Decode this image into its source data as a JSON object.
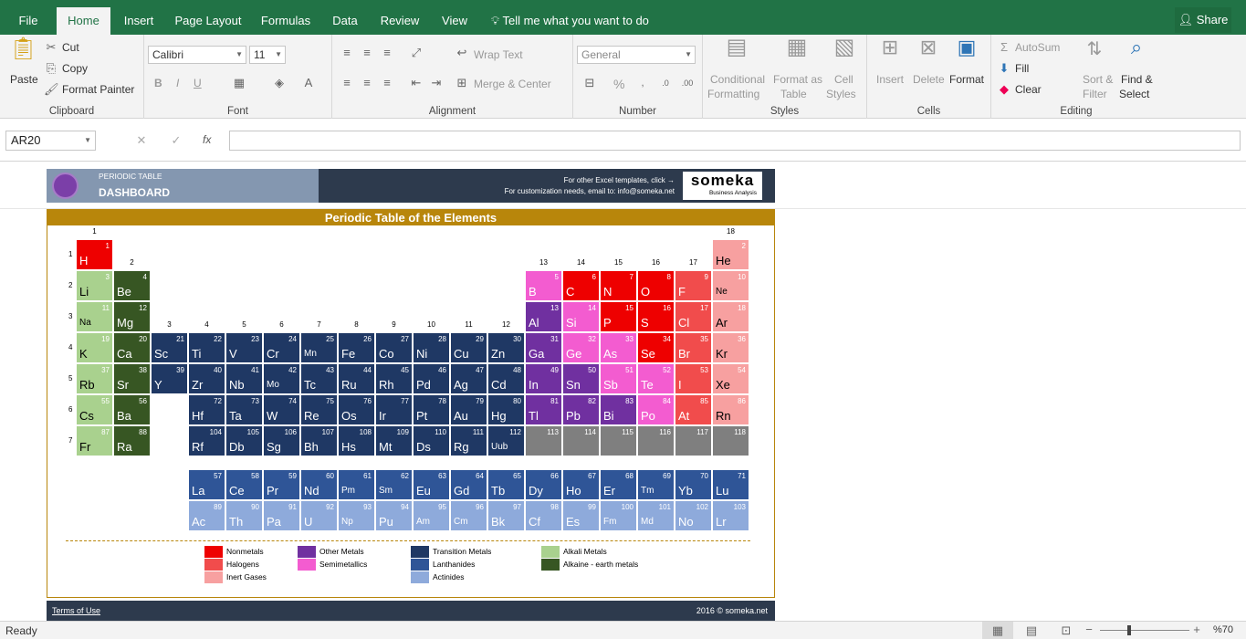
{
  "tabs": [
    "File",
    "Home",
    "Insert",
    "Page Layout",
    "Formulas",
    "Data",
    "Review",
    "View"
  ],
  "tell_me": "Tell me what you want to do",
  "share": "Share",
  "clipboard": {
    "paste": "Paste",
    "cut": "Cut",
    "copy": "Copy",
    "format_painter": "Format Painter",
    "label": "Clipboard"
  },
  "font": {
    "name": "Calibri",
    "size": "11",
    "label": "Font",
    "bold": "B",
    "italic": "I",
    "underline": "U"
  },
  "alignment": {
    "wrap": "Wrap Text",
    "merge": "Merge & Center",
    "label": "Alignment"
  },
  "number": {
    "format": "General",
    "label": "Number",
    "percent": "%"
  },
  "styles": {
    "cond1": "Conditional",
    "cond2": "Formatting",
    "fmt1": "Format as",
    "fmt2": "Table",
    "cell1": "Cell",
    "cell2": "Styles",
    "label": "Styles"
  },
  "cells": {
    "insert": "Insert",
    "delete": "Delete",
    "format": "Format",
    "label": "Cells"
  },
  "editing": {
    "autosum": "AutoSum",
    "fill": "Fill",
    "clear": "Clear",
    "sort1": "Sort &",
    "sort2": "Filter",
    "find1": "Find &",
    "find2": "Select",
    "label": "Editing"
  },
  "namebox": "AR20",
  "fx": "fx",
  "banner": {
    "small": "PERIODIC TABLE",
    "big": "DASHBOARD",
    "line1": "For other Excel templates, click →",
    "line2": "For customization needs, email to: info@someka.net",
    "brand": "someka",
    "brand_sub": "Business Analysis"
  },
  "table_title": "Periodic Table of the Elements",
  "group_labels": [
    "1",
    "2",
    "3",
    "4",
    "5",
    "6",
    "7",
    "8",
    "9",
    "10",
    "11",
    "12",
    "13",
    "14",
    "15",
    "16",
    "17",
    "18"
  ],
  "period_labels": [
    "1",
    "2",
    "3",
    "4",
    "5",
    "6",
    "7"
  ],
  "colors": {
    "nonmetal": "#ee0000",
    "halogen": "#f14c4c",
    "inert": "#f7a0a0",
    "other": "#7030a0",
    "semi": "#f35cd0",
    "transition": "#1f3864",
    "lanth": "#2f5597",
    "actin": "#8eaadb",
    "alkali": "#a9d18e",
    "alkaline": "#375623",
    "unknown": "#7f7f7f"
  },
  "elements": [
    {
      "n": "1",
      "s": "H",
      "c": "nonmetal",
      "g": 1,
      "p": 1
    },
    {
      "n": "2",
      "s": "He",
      "c": "inert",
      "g": 18,
      "p": 1
    },
    {
      "n": "3",
      "s": "Li",
      "c": "alkali",
      "g": 1,
      "p": 2
    },
    {
      "n": "4",
      "s": "Be",
      "c": "alkaline",
      "g": 2,
      "p": 2
    },
    {
      "n": "5",
      "s": "B",
      "c": "semi",
      "g": 13,
      "p": 2
    },
    {
      "n": "6",
      "s": "C",
      "c": "nonmetal",
      "g": 14,
      "p": 2
    },
    {
      "n": "7",
      "s": "N",
      "c": "nonmetal",
      "g": 15,
      "p": 2
    },
    {
      "n": "8",
      "s": "O",
      "c": "nonmetal",
      "g": 16,
      "p": 2
    },
    {
      "n": "9",
      "s": "F",
      "c": "halogen",
      "g": 17,
      "p": 2
    },
    {
      "n": "10",
      "s": "Ne",
      "c": "inert",
      "g": 18,
      "p": 2,
      "sm": 1
    },
    {
      "n": "11",
      "s": "Na",
      "c": "alkali",
      "g": 1,
      "p": 3,
      "sm": 1
    },
    {
      "n": "12",
      "s": "Mg",
      "c": "alkaline",
      "g": 2,
      "p": 3
    },
    {
      "n": "13",
      "s": "Al",
      "c": "other",
      "g": 13,
      "p": 3
    },
    {
      "n": "14",
      "s": "Si",
      "c": "semi",
      "g": 14,
      "p": 3
    },
    {
      "n": "15",
      "s": "P",
      "c": "nonmetal",
      "g": 15,
      "p": 3
    },
    {
      "n": "16",
      "s": "S",
      "c": "nonmetal",
      "g": 16,
      "p": 3
    },
    {
      "n": "17",
      "s": "Cl",
      "c": "halogen",
      "g": 17,
      "p": 3
    },
    {
      "n": "18",
      "s": "Ar",
      "c": "inert",
      "g": 18,
      "p": 3
    },
    {
      "n": "19",
      "s": "K",
      "c": "alkali",
      "g": 1,
      "p": 4
    },
    {
      "n": "20",
      "s": "Ca",
      "c": "alkaline",
      "g": 2,
      "p": 4
    },
    {
      "n": "21",
      "s": "Sc",
      "c": "transition",
      "g": 3,
      "p": 4
    },
    {
      "n": "22",
      "s": "Ti",
      "c": "transition",
      "g": 4,
      "p": 4
    },
    {
      "n": "23",
      "s": "V",
      "c": "transition",
      "g": 5,
      "p": 4
    },
    {
      "n": "24",
      "s": "Cr",
      "c": "transition",
      "g": 6,
      "p": 4
    },
    {
      "n": "25",
      "s": "Mn",
      "c": "transition",
      "g": 7,
      "p": 4,
      "sm": 1
    },
    {
      "n": "26",
      "s": "Fe",
      "c": "transition",
      "g": 8,
      "p": 4
    },
    {
      "n": "27",
      "s": "Co",
      "c": "transition",
      "g": 9,
      "p": 4
    },
    {
      "n": "28",
      "s": "Ni",
      "c": "transition",
      "g": 10,
      "p": 4
    },
    {
      "n": "29",
      "s": "Cu",
      "c": "transition",
      "g": 11,
      "p": 4
    },
    {
      "n": "30",
      "s": "Zn",
      "c": "transition",
      "g": 12,
      "p": 4
    },
    {
      "n": "31",
      "s": "Ga",
      "c": "other",
      "g": 13,
      "p": 4
    },
    {
      "n": "32",
      "s": "Ge",
      "c": "semi",
      "g": 14,
      "p": 4
    },
    {
      "n": "33",
      "s": "As",
      "c": "semi",
      "g": 15,
      "p": 4
    },
    {
      "n": "34",
      "s": "Se",
      "c": "nonmetal",
      "g": 16,
      "p": 4
    },
    {
      "n": "35",
      "s": "Br",
      "c": "halogen",
      "g": 17,
      "p": 4
    },
    {
      "n": "36",
      "s": "Kr",
      "c": "inert",
      "g": 18,
      "p": 4
    },
    {
      "n": "37",
      "s": "Rb",
      "c": "alkali",
      "g": 1,
      "p": 5
    },
    {
      "n": "38",
      "s": "Sr",
      "c": "alkaline",
      "g": 2,
      "p": 5
    },
    {
      "n": "39",
      "s": "Y",
      "c": "transition",
      "g": 3,
      "p": 5
    },
    {
      "n": "40",
      "s": "Zr",
      "c": "transition",
      "g": 4,
      "p": 5
    },
    {
      "n": "41",
      "s": "Nb",
      "c": "transition",
      "g": 5,
      "p": 5
    },
    {
      "n": "42",
      "s": "Mo",
      "c": "transition",
      "g": 6,
      "p": 5,
      "sm": 1
    },
    {
      "n": "43",
      "s": "Tc",
      "c": "transition",
      "g": 7,
      "p": 5
    },
    {
      "n": "44",
      "s": "Ru",
      "c": "transition",
      "g": 8,
      "p": 5
    },
    {
      "n": "45",
      "s": "Rh",
      "c": "transition",
      "g": 9,
      "p": 5
    },
    {
      "n": "46",
      "s": "Pd",
      "c": "transition",
      "g": 10,
      "p": 5
    },
    {
      "n": "47",
      "s": "Ag",
      "c": "transition",
      "g": 11,
      "p": 5
    },
    {
      "n": "48",
      "s": "Cd",
      "c": "transition",
      "g": 12,
      "p": 5
    },
    {
      "n": "49",
      "s": "In",
      "c": "other",
      "g": 13,
      "p": 5
    },
    {
      "n": "50",
      "s": "Sn",
      "c": "other",
      "g": 14,
      "p": 5
    },
    {
      "n": "51",
      "s": "Sb",
      "c": "semi",
      "g": 15,
      "p": 5
    },
    {
      "n": "52",
      "s": "Te",
      "c": "semi",
      "g": 16,
      "p": 5
    },
    {
      "n": "53",
      "s": "I",
      "c": "halogen",
      "g": 17,
      "p": 5
    },
    {
      "n": "54",
      "s": "Xe",
      "c": "inert",
      "g": 18,
      "p": 5
    },
    {
      "n": "55",
      "s": "Cs",
      "c": "alkali",
      "g": 1,
      "p": 6
    },
    {
      "n": "56",
      "s": "Ba",
      "c": "alkaline",
      "g": 2,
      "p": 6
    },
    {
      "n": "72",
      "s": "Hf",
      "c": "transition",
      "g": 4,
      "p": 6
    },
    {
      "n": "73",
      "s": "Ta",
      "c": "transition",
      "g": 5,
      "p": 6
    },
    {
      "n": "74",
      "s": "W",
      "c": "transition",
      "g": 6,
      "p": 6
    },
    {
      "n": "75",
      "s": "Re",
      "c": "transition",
      "g": 7,
      "p": 6
    },
    {
      "n": "76",
      "s": "Os",
      "c": "transition",
      "g": 8,
      "p": 6
    },
    {
      "n": "77",
      "s": "Ir",
      "c": "transition",
      "g": 9,
      "p": 6
    },
    {
      "n": "78",
      "s": "Pt",
      "c": "transition",
      "g": 10,
      "p": 6
    },
    {
      "n": "79",
      "s": "Au",
      "c": "transition",
      "g": 11,
      "p": 6
    },
    {
      "n": "80",
      "s": "Hg",
      "c": "transition",
      "g": 12,
      "p": 6
    },
    {
      "n": "81",
      "s": "Tl",
      "c": "other",
      "g": 13,
      "p": 6
    },
    {
      "n": "82",
      "s": "Pb",
      "c": "other",
      "g": 14,
      "p": 6
    },
    {
      "n": "83",
      "s": "Bi",
      "c": "other",
      "g": 15,
      "p": 6
    },
    {
      "n": "84",
      "s": "Po",
      "c": "semi",
      "g": 16,
      "p": 6
    },
    {
      "n": "85",
      "s": "At",
      "c": "halogen",
      "g": 17,
      "p": 6
    },
    {
      "n": "86",
      "s": "Rn",
      "c": "inert",
      "g": 18,
      "p": 6
    },
    {
      "n": "87",
      "s": "Fr",
      "c": "alkali",
      "g": 1,
      "p": 7
    },
    {
      "n": "88",
      "s": "Ra",
      "c": "alkaline",
      "g": 2,
      "p": 7
    },
    {
      "n": "104",
      "s": "Rf",
      "c": "transition",
      "g": 4,
      "p": 7
    },
    {
      "n": "105",
      "s": "Db",
      "c": "transition",
      "g": 5,
      "p": 7
    },
    {
      "n": "106",
      "s": "Sg",
      "c": "transition",
      "g": 6,
      "p": 7
    },
    {
      "n": "107",
      "s": "Bh",
      "c": "transition",
      "g": 7,
      "p": 7
    },
    {
      "n": "108",
      "s": "Hs",
      "c": "transition",
      "g": 8,
      "p": 7
    },
    {
      "n": "109",
      "s": "Mt",
      "c": "transition",
      "g": 9,
      "p": 7
    },
    {
      "n": "110",
      "s": "Ds",
      "c": "transition",
      "g": 10,
      "p": 7
    },
    {
      "n": "111",
      "s": "Rg",
      "c": "transition",
      "g": 11,
      "p": 7
    },
    {
      "n": "112",
      "s": "Uub",
      "c": "transition",
      "g": 12,
      "p": 7,
      "sm": 1
    },
    {
      "n": "113",
      "s": "",
      "c": "unknown",
      "g": 13,
      "p": 7
    },
    {
      "n": "114",
      "s": "",
      "c": "unknown",
      "g": 14,
      "p": 7
    },
    {
      "n": "115",
      "s": "",
      "c": "unknown",
      "g": 15,
      "p": 7
    },
    {
      "n": "116",
      "s": "",
      "c": "unknown",
      "g": 16,
      "p": 7
    },
    {
      "n": "117",
      "s": "",
      "c": "unknown",
      "g": 17,
      "p": 7
    },
    {
      "n": "118",
      "s": "",
      "c": "unknown",
      "g": 18,
      "p": 7
    },
    {
      "n": "57",
      "s": "La",
      "c": "lanth",
      "g": 4,
      "p": 8
    },
    {
      "n": "58",
      "s": "Ce",
      "c": "lanth",
      "g": 5,
      "p": 8
    },
    {
      "n": "59",
      "s": "Pr",
      "c": "lanth",
      "g": 6,
      "p": 8
    },
    {
      "n": "60",
      "s": "Nd",
      "c": "lanth",
      "g": 7,
      "p": 8
    },
    {
      "n": "61",
      "s": "Pm",
      "c": "lanth",
      "g": 8,
      "p": 8,
      "sm": 1
    },
    {
      "n": "62",
      "s": "Sm",
      "c": "lanth",
      "g": 9,
      "p": 8,
      "sm": 1
    },
    {
      "n": "63",
      "s": "Eu",
      "c": "lanth",
      "g": 10,
      "p": 8
    },
    {
      "n": "64",
      "s": "Gd",
      "c": "lanth",
      "g": 11,
      "p": 8
    },
    {
      "n": "65",
      "s": "Tb",
      "c": "lanth",
      "g": 12,
      "p": 8
    },
    {
      "n": "66",
      "s": "Dy",
      "c": "lanth",
      "g": 13,
      "p": 8
    },
    {
      "n": "67",
      "s": "Ho",
      "c": "lanth",
      "g": 14,
      "p": 8
    },
    {
      "n": "68",
      "s": "Er",
      "c": "lanth",
      "g": 15,
      "p": 8
    },
    {
      "n": "69",
      "s": "Tm",
      "c": "lanth",
      "g": 16,
      "p": 8,
      "sm": 1
    },
    {
      "n": "70",
      "s": "Yb",
      "c": "lanth",
      "g": 17,
      "p": 8
    },
    {
      "n": "71",
      "s": "Lu",
      "c": "lanth",
      "g": 18,
      "p": 8
    },
    {
      "n": "89",
      "s": "Ac",
      "c": "actin",
      "g": 4,
      "p": 9
    },
    {
      "n": "90",
      "s": "Th",
      "c": "actin",
      "g": 5,
      "p": 9
    },
    {
      "n": "91",
      "s": "Pa",
      "c": "actin",
      "g": 6,
      "p": 9
    },
    {
      "n": "92",
      "s": "U",
      "c": "actin",
      "g": 7,
      "p": 9
    },
    {
      "n": "93",
      "s": "Np",
      "c": "actin",
      "g": 8,
      "p": 9,
      "sm": 1
    },
    {
      "n": "94",
      "s": "Pu",
      "c": "actin",
      "g": 9,
      "p": 9
    },
    {
      "n": "95",
      "s": "Am",
      "c": "actin",
      "g": 10,
      "p": 9,
      "sm": 1
    },
    {
      "n": "96",
      "s": "Cm",
      "c": "actin",
      "g": 11,
      "p": 9,
      "sm": 1
    },
    {
      "n": "97",
      "s": "Bk",
      "c": "actin",
      "g": 12,
      "p": 9
    },
    {
      "n": "98",
      "s": "Cf",
      "c": "actin",
      "g": 13,
      "p": 9
    },
    {
      "n": "99",
      "s": "Es",
      "c": "actin",
      "g": 14,
      "p": 9
    },
    {
      "n": "100",
      "s": "Fm",
      "c": "actin",
      "g": 15,
      "p": 9,
      "sm": 1
    },
    {
      "n": "101",
      "s": "Md",
      "c": "actin",
      "g": 16,
      "p": 9,
      "sm": 1
    },
    {
      "n": "102",
      "s": "No",
      "c": "actin",
      "g": 17,
      "p": 9
    },
    {
      "n": "103",
      "s": "Lr",
      "c": "actin",
      "g": 18,
      "p": 9
    }
  ],
  "legend": [
    {
      "label": "Nonmetals",
      "c": "nonmetal"
    },
    {
      "label": "Halogens",
      "c": "halogen"
    },
    {
      "label": "Inert Gases",
      "c": "inert"
    },
    {
      "label": "Other Metals",
      "c": "other"
    },
    {
      "label": "Semimetallics",
      "c": "semi"
    },
    {
      "label": "Transition Metals",
      "c": "transition"
    },
    {
      "label": "Lanthanides",
      "c": "lanth"
    },
    {
      "label": "Actinides",
      "c": "actin"
    },
    {
      "label": "Alkali Metals",
      "c": "alkali"
    },
    {
      "label": "Alkaine - earth metals",
      "c": "alkaline"
    }
  ],
  "footer": {
    "terms": "Terms of Use",
    "copy": "2016 © someka.net"
  },
  "status": {
    "ready": "Ready",
    "zoom": "%70"
  }
}
